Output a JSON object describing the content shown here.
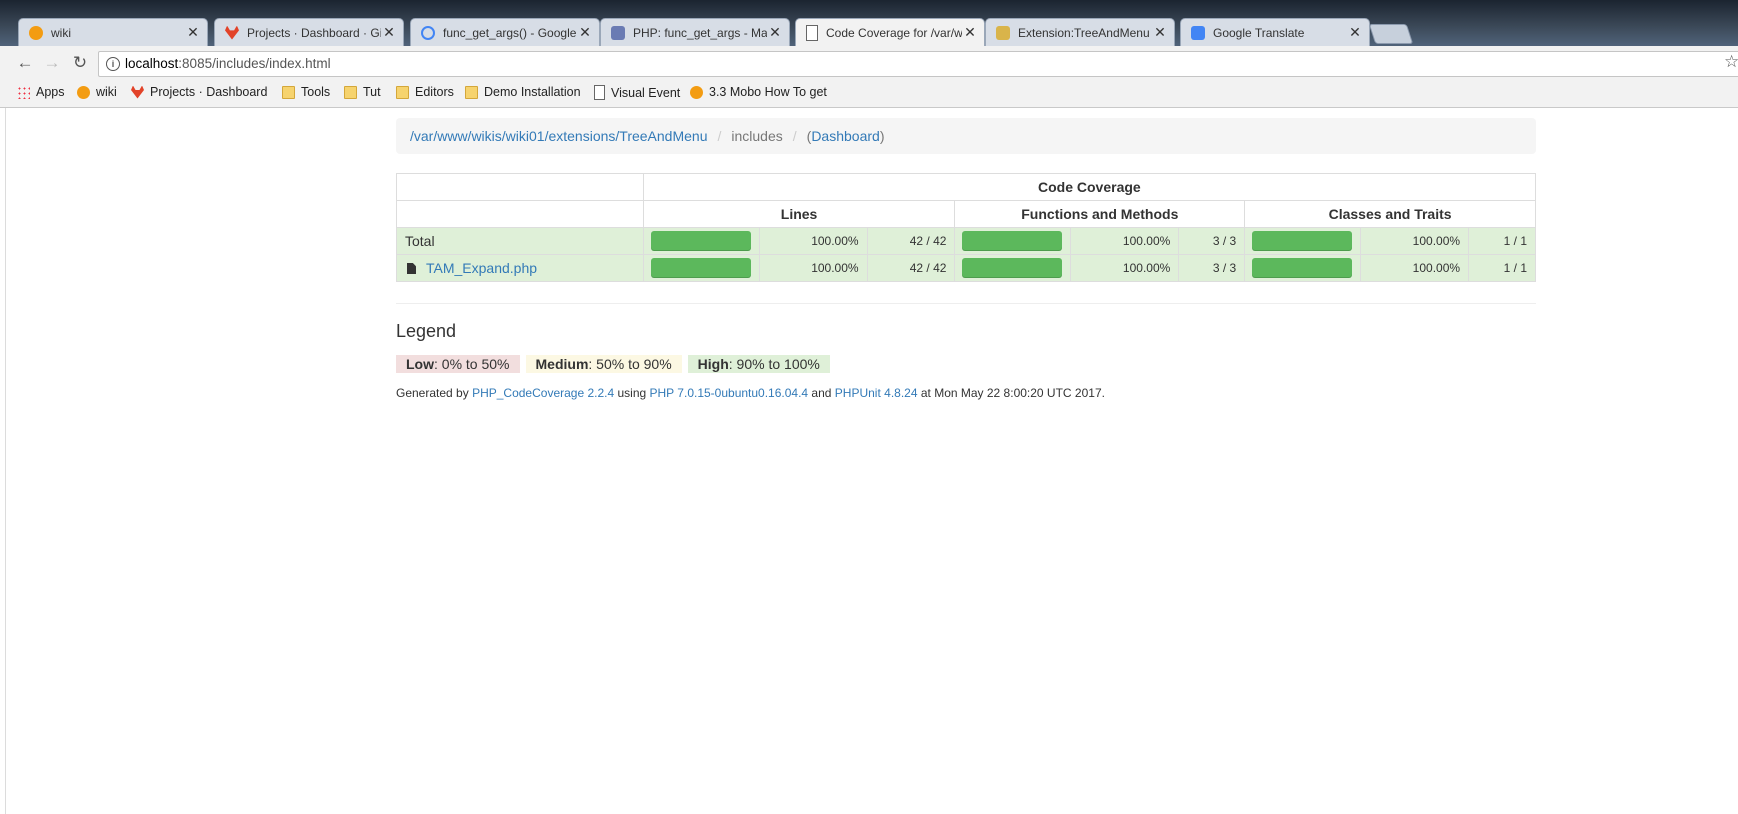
{
  "browser": {
    "tabs": [
      {
        "label": "wiki",
        "icon": "wiki-icon",
        "color": "#f39c12"
      },
      {
        "label": "Projects · Dashboard · Git",
        "icon": "gitlab-icon",
        "color": "#e24329"
      },
      {
        "label": "func_get_args() - Google",
        "icon": "google-icon",
        "color": "#4285f4"
      },
      {
        "label": "PHP: func_get_args - Ma",
        "icon": "php-icon",
        "color": "#6a7bb3"
      },
      {
        "label": "Code Coverage for /var/w",
        "icon": "page-icon",
        "color": "#ffffff"
      },
      {
        "label": "Extension:TreeAndMenu",
        "icon": "mediawiki-icon",
        "color": "#d9b44a"
      },
      {
        "label": "Google Translate",
        "icon": "translate-icon",
        "color": "#4285f4"
      }
    ],
    "close_glyph": "✕",
    "url_host": "localhost",
    "url_rest": ":8085/includes/index.html",
    "bookmarks": [
      {
        "label": "Apps",
        "icon": "apps-icon"
      },
      {
        "label": "wiki",
        "icon": "wiki-icon"
      },
      {
        "label": "Projects · Dashboard",
        "icon": "gitlab-icon"
      },
      {
        "label": "Tools",
        "icon": "folder-icon"
      },
      {
        "label": "Tut",
        "icon": "folder-icon"
      },
      {
        "label": "Editors",
        "icon": "folder-icon"
      },
      {
        "label": "Demo Installation",
        "icon": "folder-icon"
      },
      {
        "label": "Visual Event",
        "icon": "page-icon"
      },
      {
        "label": "3.3 Mobo How To get",
        "icon": "wiki-icon"
      }
    ]
  },
  "breadcrumb": {
    "root": "/var/www/wikis/wiki01/extensions/TreeAndMenu",
    "current": "includes",
    "dashboard": "Dashboard"
  },
  "coverage": {
    "title": "Code Coverage",
    "columns": {
      "lines": "Lines",
      "functions": "Functions and Methods",
      "classes": "Classes and Traits"
    },
    "rows": [
      {
        "name": "Total",
        "lines_pct": "100.00%",
        "lines_count": "42 / 42",
        "functions_pct": "100.00%",
        "functions_count": "3 / 3",
        "classes_pct": "100.00%",
        "classes_count": "1 / 1",
        "lines_fill": 1.0,
        "functions_fill": 1.0,
        "classes_fill": 1.0
      },
      {
        "name": "TAM_Expand.php",
        "lines_pct": "100.00%",
        "lines_count": "42 / 42",
        "functions_pct": "100.00%",
        "functions_count": "3 / 3",
        "classes_pct": "100.00%",
        "classes_count": "1 / 1",
        "lines_fill": 1.0,
        "functions_fill": 1.0,
        "classes_fill": 1.0
      }
    ]
  },
  "legend": {
    "title": "Legend",
    "low_label": "Low",
    "low_range": ": 0% to 50%",
    "medium_label": "Medium",
    "medium_range": ": 50% to 90%",
    "high_label": "High",
    "high_range": ": 90% to 100%"
  },
  "footer": {
    "prefix": "Generated by ",
    "tool": "PHP_CodeCoverage 2.2.4",
    "using": " using ",
    "php": "PHP 7.0.15-0ubuntu0.16.04.4",
    "and": " and ",
    "phpunit": "PHPUnit 4.8.24",
    "suffix": " at Mon May 22 8:00:20 UTC 2017."
  }
}
